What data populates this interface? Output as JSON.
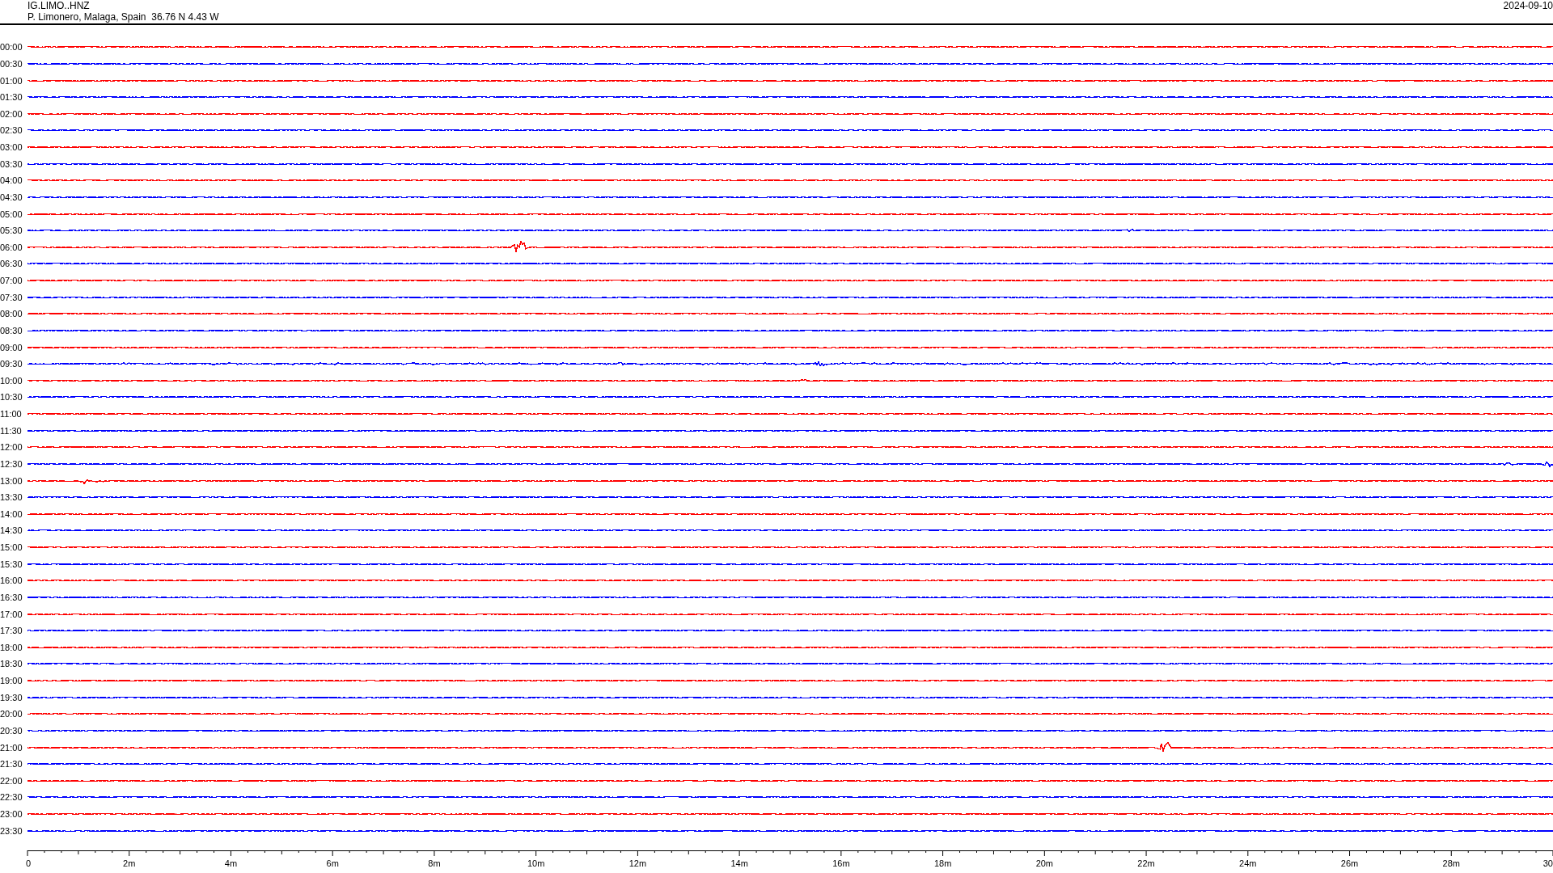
{
  "header": {
    "station": "IG.LIMO..HNZ",
    "location": "P. Limonero, Malaga, Spain  36.76 N 4.43 W",
    "date": "2024-09-10"
  },
  "traces": [
    {
      "time": "00:00",
      "color": "#ff0000"
    },
    {
      "time": "00:30",
      "color": "#0000ff"
    },
    {
      "time": "01:00",
      "color": "#ff0000"
    },
    {
      "time": "01:30",
      "color": "#0000ff"
    },
    {
      "time": "02:00",
      "color": "#ff0000"
    },
    {
      "time": "02:30",
      "color": "#0000ff"
    },
    {
      "time": "03:00",
      "color": "#ff0000"
    },
    {
      "time": "03:30",
      "color": "#0000ff"
    },
    {
      "time": "04:00",
      "color": "#ff0000"
    },
    {
      "time": "04:30",
      "color": "#0000ff"
    },
    {
      "time": "05:00",
      "color": "#ff0000"
    },
    {
      "time": "05:30",
      "color": "#0000ff"
    },
    {
      "time": "06:00",
      "color": "#ff0000"
    },
    {
      "time": "06:30",
      "color": "#0000ff"
    },
    {
      "time": "07:00",
      "color": "#ff0000"
    },
    {
      "time": "07:30",
      "color": "#0000ff"
    },
    {
      "time": "08:00",
      "color": "#ff0000"
    },
    {
      "time": "08:30",
      "color": "#0000ff"
    },
    {
      "time": "09:00",
      "color": "#ff0000"
    },
    {
      "time": "09:30",
      "color": "#0000ff"
    },
    {
      "time": "10:00",
      "color": "#ff0000"
    },
    {
      "time": "10:30",
      "color": "#0000ff"
    },
    {
      "time": "11:00",
      "color": "#ff0000"
    },
    {
      "time": "11:30",
      "color": "#0000ff"
    },
    {
      "time": "12:00",
      "color": "#ff0000"
    },
    {
      "time": "12:30",
      "color": "#0000ff"
    },
    {
      "time": "13:00",
      "color": "#ff0000"
    },
    {
      "time": "13:30",
      "color": "#0000ff"
    },
    {
      "time": "14:00",
      "color": "#ff0000"
    },
    {
      "time": "14:30",
      "color": "#0000ff"
    },
    {
      "time": "15:00",
      "color": "#ff0000"
    },
    {
      "time": "15:30",
      "color": "#0000ff"
    },
    {
      "time": "16:00",
      "color": "#ff0000"
    },
    {
      "time": "16:30",
      "color": "#0000ff"
    },
    {
      "time": "17:00",
      "color": "#ff0000"
    },
    {
      "time": "17:30",
      "color": "#0000ff"
    },
    {
      "time": "18:00",
      "color": "#ff0000"
    },
    {
      "time": "18:30",
      "color": "#0000ff"
    },
    {
      "time": "19:00",
      "color": "#ff0000"
    },
    {
      "time": "19:30",
      "color": "#0000ff"
    },
    {
      "time": "20:00",
      "color": "#ff0000"
    },
    {
      "time": "20:30",
      "color": "#0000ff"
    },
    {
      "time": "21:00",
      "color": "#ff0000"
    },
    {
      "time": "21:30",
      "color": "#0000ff"
    },
    {
      "time": "22:00",
      "color": "#ff0000"
    },
    {
      "time": "22:30",
      "color": "#0000ff"
    },
    {
      "time": "23:00",
      "color": "#ff0000"
    },
    {
      "time": "23:30",
      "color": "#0000ff"
    }
  ],
  "time_axis": {
    "labels": [
      "0",
      "2m",
      "4m",
      "6m",
      "8m",
      "10m",
      "12m",
      "14m",
      "16m",
      "18m",
      "20m",
      "22m",
      "24m",
      "26m",
      "28m",
      "30"
    ]
  }
}
